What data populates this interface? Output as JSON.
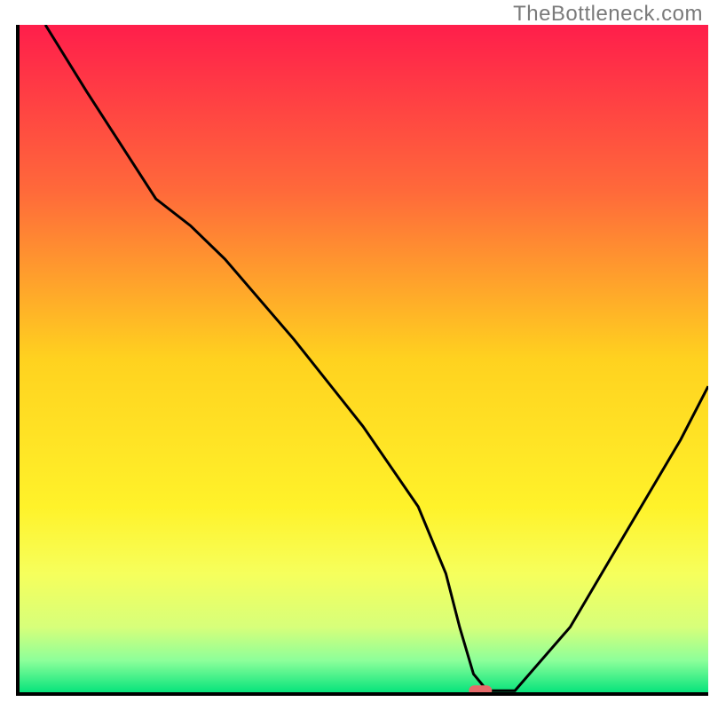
{
  "watermark": "TheBottleneck.com",
  "chart_data": {
    "type": "line",
    "title": "",
    "xlabel": "",
    "ylabel": "",
    "xlim": [
      0,
      100
    ],
    "ylim": [
      0,
      100
    ],
    "x": [
      4,
      10,
      20,
      25,
      30,
      40,
      50,
      58,
      62,
      64,
      66,
      68,
      72,
      80,
      88,
      96,
      100
    ],
    "values": [
      100,
      90,
      74,
      70,
      65,
      53,
      40,
      28,
      18,
      10,
      3,
      0.5,
      0.5,
      10,
      24,
      38,
      46
    ],
    "marker": {
      "x": 67,
      "y": 0.5,
      "color": "#e66a6a",
      "shape": "pill"
    },
    "gradient_stops": [
      {
        "offset": 0.0,
        "color": "#ff1e4b"
      },
      {
        "offset": 0.25,
        "color": "#ff6a3a"
      },
      {
        "offset": 0.5,
        "color": "#ffd21f"
      },
      {
        "offset": 0.72,
        "color": "#fff22a"
      },
      {
        "offset": 0.82,
        "color": "#f6ff5c"
      },
      {
        "offset": 0.9,
        "color": "#d7ff7a"
      },
      {
        "offset": 0.95,
        "color": "#8cff9a"
      },
      {
        "offset": 1.0,
        "color": "#00e27a"
      }
    ],
    "axis_color": "#000000",
    "line_color": "#000000"
  }
}
